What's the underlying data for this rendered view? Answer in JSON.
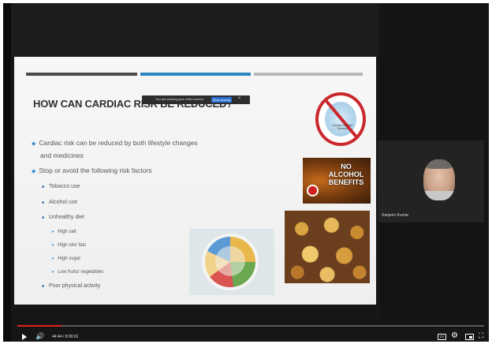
{
  "slide": {
    "title": "HOW CAN CARDIAC RISK BE REDUCED?",
    "bullets": [
      {
        "level": 1,
        "text": "Cardiac risk can be reduced by both lifestyle changes"
      },
      {
        "level": 1,
        "text": "and medicines",
        "continuation": true
      },
      {
        "level": 1,
        "text": "Stop or avoid the following risk factors"
      },
      {
        "level": 2,
        "text": "Tobacco use"
      },
      {
        "level": 2,
        "text": "Alcohol use"
      },
      {
        "level": 2,
        "text": "Unhealthy diet"
      },
      {
        "level": 3,
        "text": "High salt"
      },
      {
        "level": 3,
        "text": "High oils/ fats"
      },
      {
        "level": 3,
        "text": "High sugar"
      },
      {
        "level": 3,
        "text": "Low fruits/ vegetables"
      },
      {
        "level": 2,
        "text": "Poor physical activity"
      }
    ],
    "images": {
      "tobacco_badge_text": "Choose Life Not Tobacco",
      "alcohol_text": "NO ALCOHOL BENEFITS"
    }
  },
  "screen_share": {
    "message": "You are sharing your entire screen.",
    "stop_label": "Stop sharing",
    "hide_label": "×"
  },
  "participant": {
    "name": "Sanjeev Kumar"
  },
  "player": {
    "time": "44:44 / 8:00:01",
    "progress": 0.094,
    "accent_color": "#e62117"
  },
  "icons": [
    "play-icon",
    "volume-icon",
    "captions-icon",
    "gear-icon",
    "miniplayer-icon",
    "fullscreen-icon"
  ]
}
